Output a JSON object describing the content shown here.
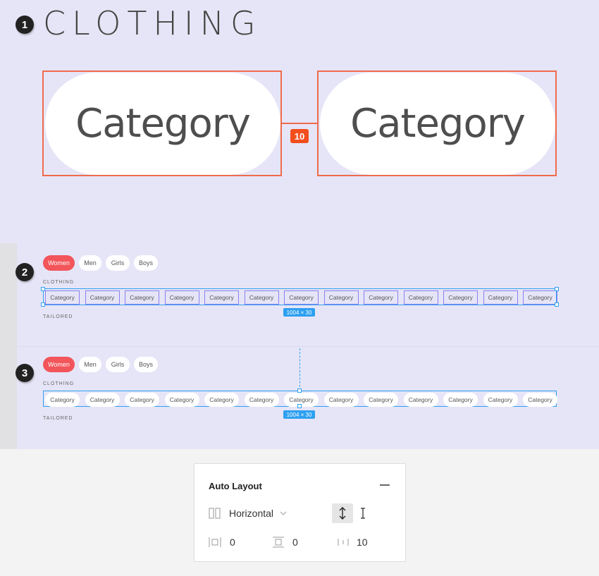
{
  "sections": [
    {
      "number": "1"
    },
    {
      "number": "2"
    },
    {
      "number": "3"
    }
  ],
  "zoomed": {
    "title": "CLOTHING",
    "items": [
      "Category",
      "Category"
    ],
    "spacing_badge": "10"
  },
  "chips": [
    "Women",
    "Men",
    "Girls",
    "Boys"
  ],
  "row_labels": {
    "top": "CLOTHING",
    "bottom": "TAILORED"
  },
  "row_items": [
    "Category",
    "Category",
    "Category",
    "Category",
    "Category",
    "Category",
    "Category",
    "Category",
    "Category",
    "Category",
    "Category",
    "Category",
    "Category"
  ],
  "size_tag": "1004 × 30",
  "panel": {
    "title": "Auto Layout",
    "collapse_icon": "minus-icon",
    "direction": "Horizontal",
    "padding_horizontal": "0",
    "padding_vertical": "0",
    "spacing": "10"
  },
  "colors": {
    "canvas": "#e6e5f7",
    "accent_red": "#f24e1e",
    "chip_active": "#f2555a",
    "selection_blue": "#2ea0f0",
    "frame_purple": "#8a80f0"
  }
}
